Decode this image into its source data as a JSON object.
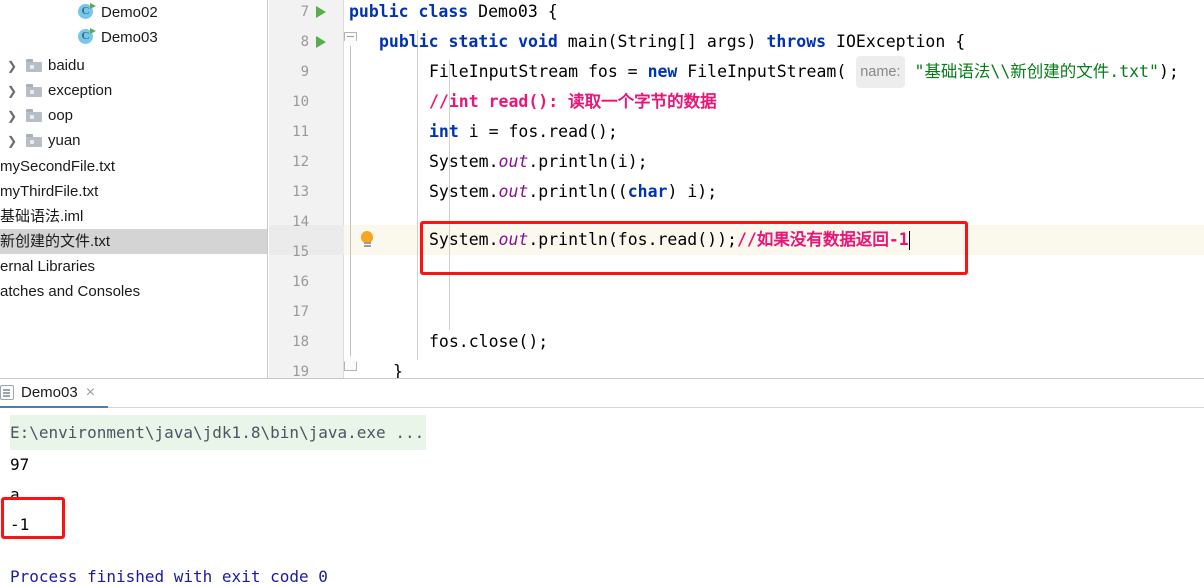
{
  "sidebar": {
    "items": [
      {
        "label": "Demo02",
        "icon": "java-class-icon",
        "indent": 78,
        "chevron": false,
        "selected": false,
        "type": "class"
      },
      {
        "label": "Demo03",
        "icon": "java-class-icon",
        "indent": 78,
        "chevron": false,
        "selected": false,
        "type": "class"
      },
      {
        "label": "baidu",
        "icon": "folder-icon",
        "indent": 26,
        "chevron": true,
        "selected": false,
        "type": "folder"
      },
      {
        "label": "exception",
        "icon": "folder-icon",
        "indent": 26,
        "chevron": true,
        "selected": false,
        "type": "folder"
      },
      {
        "label": "oop",
        "icon": "folder-icon",
        "indent": 26,
        "chevron": true,
        "selected": false,
        "type": "folder"
      },
      {
        "label": "yuan",
        "icon": "folder-icon",
        "indent": 26,
        "chevron": true,
        "selected": false,
        "type": "folder"
      },
      {
        "label": "mySecondFile.txt",
        "icon": "",
        "indent": 0,
        "chevron": false,
        "selected": false,
        "type": "file"
      },
      {
        "label": "myThirdFile.txt",
        "icon": "",
        "indent": 0,
        "chevron": false,
        "selected": false,
        "type": "file"
      },
      {
        "label": "基础语法.iml",
        "icon": "",
        "indent": 0,
        "chevron": false,
        "selected": false,
        "type": "file"
      },
      {
        "label": "新创建的文件.txt",
        "icon": "",
        "indent": 0,
        "chevron": false,
        "selected": true,
        "type": "file"
      },
      {
        "label": "ernal Libraries",
        "icon": "",
        "indent": 0,
        "chevron": false,
        "selected": false,
        "type": "node"
      },
      {
        "label": "atches and Consoles",
        "icon": "",
        "indent": 0,
        "chevron": false,
        "selected": false,
        "type": "node"
      }
    ]
  },
  "editor": {
    "lines": [
      {
        "num": "7",
        "run": true,
        "indent": 0
      },
      {
        "num": "8",
        "run": true,
        "indent": 0
      },
      {
        "num": "9",
        "run": false,
        "indent": 0
      },
      {
        "num": "10",
        "run": false,
        "indent": 0
      },
      {
        "num": "11",
        "run": false,
        "indent": 0
      },
      {
        "num": "12",
        "run": false,
        "indent": 0
      },
      {
        "num": "13",
        "run": false,
        "indent": 0
      },
      {
        "num": "14",
        "run": false,
        "indent": 0
      },
      {
        "num": "15",
        "run": false,
        "indent": 0
      },
      {
        "num": "16",
        "run": false,
        "indent": 0
      },
      {
        "num": "17",
        "run": false,
        "indent": 0
      },
      {
        "num": "18",
        "run": false,
        "indent": 0
      },
      {
        "num": "19",
        "run": false,
        "indent": 0
      }
    ],
    "code": {
      "l7_kw_public": "public",
      "l7_kw_class": "class",
      "l7_name": "Demo03",
      "l7_brace": "{",
      "l8_public": "public",
      "l8_static": "static",
      "l8_void": "void",
      "l8_main": "main",
      "l8_args": "(String[] args)",
      "l8_throws": "throws",
      "l8_exc": "IOException",
      "l8_brace": "{",
      "l9_type": "FileInputStream",
      "l9_var": " fos = ",
      "l9_new": "new",
      "l9_ctor": " FileInputStream(",
      "l9_hint": "name:",
      "l9_str": "\"基础语法\\\\新创建的文件.txt\"",
      "l9_tail": ");",
      "l10_comment": "//int read(): 读取一个字节的数据",
      "l11_int": "int",
      "l11_rest": " i = fos.read();",
      "l12_sys": "System.",
      "l12_out": "out",
      "l12_rest": ".println(i);",
      "l13_sys": "System.",
      "l13_out": "out",
      "l13_mid": ".println((",
      "l13_char": "char",
      "l13_rest": ") i);",
      "l15_sys": "System.",
      "l15_out": "out",
      "l15_mid": ".println(fos.read());",
      "l15_comment": "//如果没有数据返回-1",
      "l18_close": "fos.close();",
      "l19_brace": "}"
    }
  },
  "console": {
    "tab_label": "Demo03",
    "tab_close": "×",
    "command": "E:\\environment\\java\\jdk1.8\\bin\\java.exe ...",
    "output": [
      "97",
      "a",
      "-1"
    ],
    "exit": "Process finished with exit code 0"
  },
  "annotations": {
    "editor_box_label": "highlighted-code-line",
    "console_box_label": "highlighted-output-value"
  },
  "colors": {
    "keyword": "#0033b3",
    "string": "#067d17",
    "comment": "#ea1577",
    "field": "#871094",
    "number": "#1750eb",
    "annotation_red": "#ff1111",
    "caret_line": "#fbf8ee",
    "selection_gray": "#d4d4d4",
    "console_cmd_bg": "#e9f5e9",
    "exit_blue": "#1a1aa6"
  }
}
